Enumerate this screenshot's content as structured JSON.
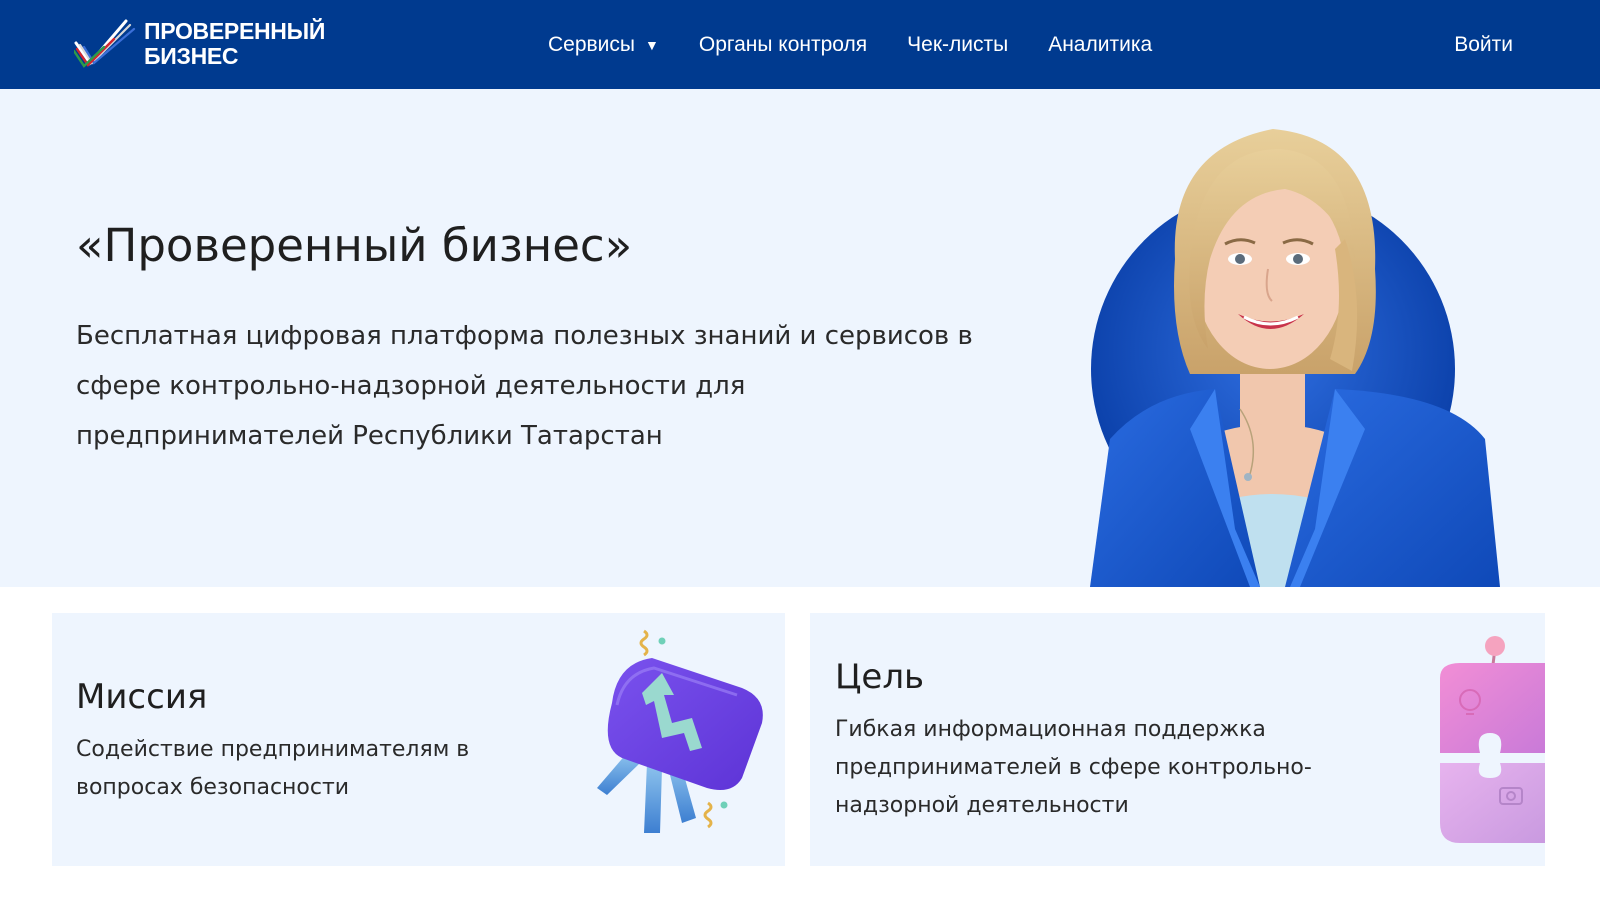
{
  "brand": {
    "name_line1": "ПРОВЕРЕННЫЙ",
    "name_line2": "БИЗНЕС"
  },
  "nav": {
    "items": [
      {
        "label": "Сервисы",
        "has_dropdown": true
      },
      {
        "label": "Органы контроля"
      },
      {
        "label": "Чек-листы"
      },
      {
        "label": "Аналитика"
      }
    ],
    "login_label": "Войти"
  },
  "hero": {
    "title": "«Проверенный бизнес»",
    "description": "Бесплатная цифровая платформа полезных знаний и сервисов в сфере контрольно-надзорной деятельности для предпринимателей Республики Татарстан"
  },
  "cards": [
    {
      "title": "Миссия",
      "text": "Содействие предпринимателям в вопросах безопасности"
    },
    {
      "title": "Цель",
      "text": "Гибкая информационная поддержка предпринимателей в сфере контрольно-надзорной деятельности"
    }
  ],
  "colors": {
    "header_bg": "#003a8f",
    "hero_bg": "#eef5fe",
    "card_bg": "#eef5fe",
    "accent_blue": "#1557c8"
  },
  "icons": {
    "logo": "checkmark-tricolor-logo",
    "dropdown": "caret-down-icon"
  }
}
